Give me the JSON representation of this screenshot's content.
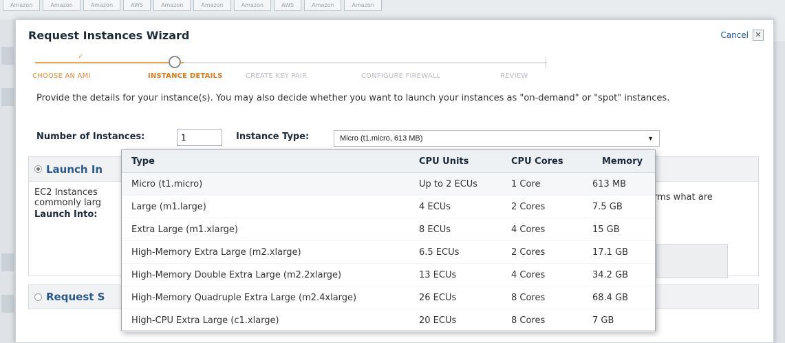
{
  "browser_tabs": [
    "Amazon",
    "Amazon",
    "Amazon",
    "AWS",
    "Amazon",
    "Amazon",
    "Amazon",
    "AWS",
    "Amazon",
    "Amazon"
  ],
  "wizard": {
    "title": "Request Instances Wizard",
    "cancel_label": "Cancel",
    "close_glyph": "✕",
    "steps": [
      {
        "label": "CHOOSE AN AMI",
        "state": "done"
      },
      {
        "label": "INSTANCE DETAILS",
        "state": "active"
      },
      {
        "label": "CREATE KEY PAIR",
        "state": "future"
      },
      {
        "label": "CONFIGURE FIREWALL",
        "state": "future"
      },
      {
        "label": "REVIEW",
        "state": "future"
      }
    ],
    "check_glyph": "✓",
    "intro": "Provide the details for your instance(s). You may also decide whether you want to launch your instances as \"on-demand\" or \"spot\" instances.",
    "num_instances_label": "Number of Instances:",
    "num_instances_value": "1",
    "instance_type_label": "Instance Type:",
    "instance_type_selected": "Micro (t1.micro, 613 MB)",
    "launch_panel_title": "Launch In",
    "ec2_text_line1": "EC2 Instances",
    "ec2_text_line2": "commonly larg",
    "ec2_text_right": "rms what are",
    "launch_into_label": "Launch Into:",
    "request_panel_title": "Request S"
  },
  "dropdown": {
    "headers": {
      "type": "Type",
      "cpu_units": "CPU Units",
      "cpu_cores": "CPU Cores",
      "memory": "Memory"
    },
    "rows": [
      {
        "type": "Micro (t1.micro)",
        "cpu_units": "Up to 2 ECUs",
        "cpu_cores": "1 Core",
        "memory": "613 MB"
      },
      {
        "type": "Large (m1.large)",
        "cpu_units": "4 ECUs",
        "cpu_cores": "2 Cores",
        "memory": "7.5 GB"
      },
      {
        "type": "Extra Large (m1.xlarge)",
        "cpu_units": "8 ECUs",
        "cpu_cores": "4 Cores",
        "memory": "15 GB"
      },
      {
        "type": "High-Memory Extra Large (m2.xlarge)",
        "cpu_units": "6.5 ECUs",
        "cpu_cores": "2 Cores",
        "memory": "17.1 GB"
      },
      {
        "type": "High-Memory Double Extra Large (m2.2xlarge)",
        "cpu_units": "13 ECUs",
        "cpu_cores": "4 Cores",
        "memory": "34.2 GB"
      },
      {
        "type": "High-Memory Quadruple Extra Large (m2.4xlarge)",
        "cpu_units": "26 ECUs",
        "cpu_cores": "8 Cores",
        "memory": "68.4 GB"
      },
      {
        "type": "High-CPU Extra Large (c1.xlarge)",
        "cpu_units": "20 ECUs",
        "cpu_cores": "8 Cores",
        "memory": "7 GB"
      }
    ]
  },
  "colors": {
    "accent_orange": "#e07a16",
    "link_blue": "#1d5aa6",
    "panel_title_blue": "#2a5a8c"
  }
}
